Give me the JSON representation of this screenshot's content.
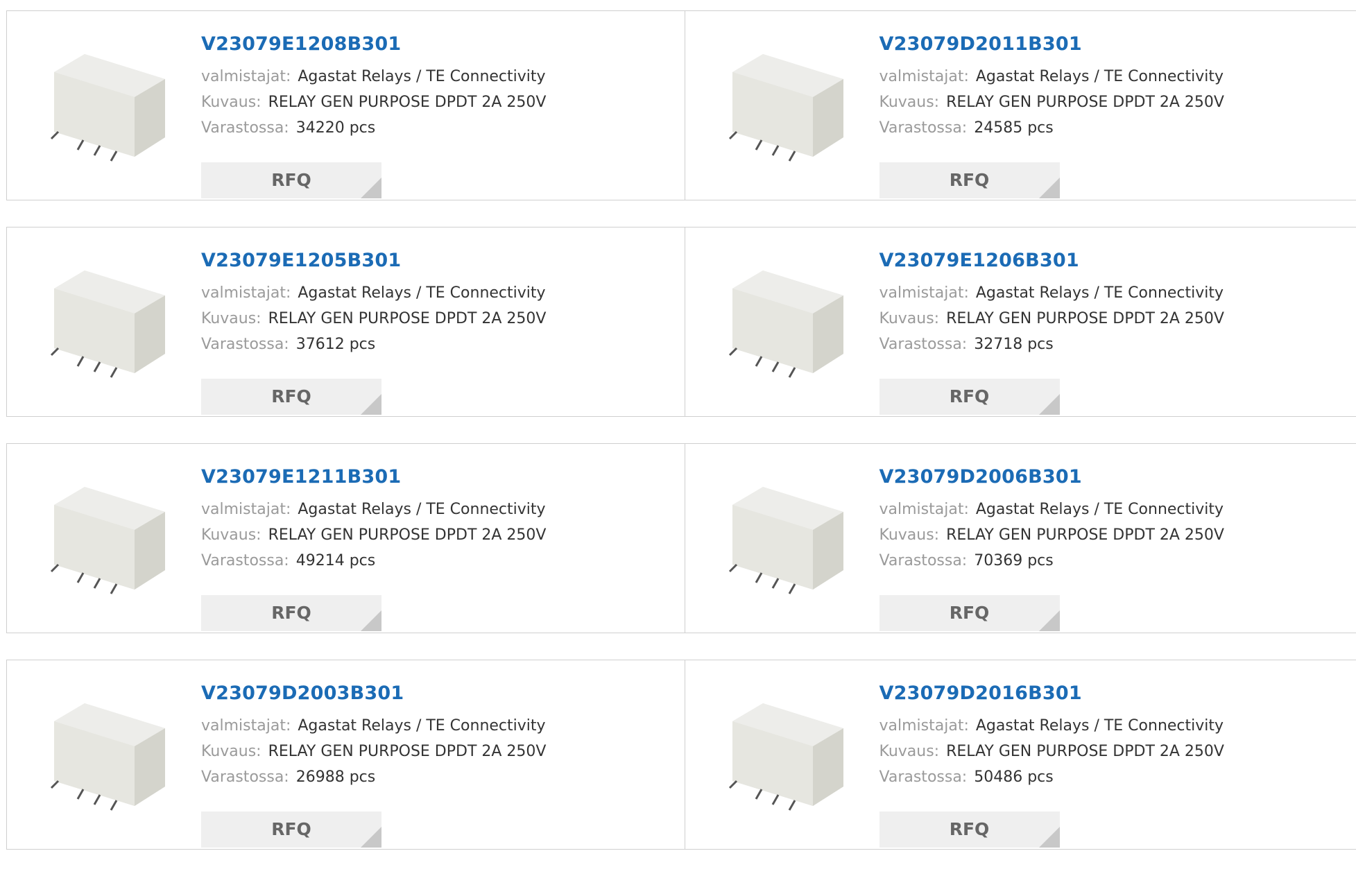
{
  "labels": {
    "manufacturer": "valmistajat:",
    "description": "Kuvaus:",
    "stock": "Varastossa:",
    "rfq": "RFQ"
  },
  "image": {
    "icon": "relay-product-image"
  },
  "colors": {
    "part_link": "#1b6bb5",
    "label": "#9a9a9a",
    "value": "#333333",
    "button_bg": "#efefef"
  },
  "products": [
    {
      "part": "V23079E1208B301",
      "manufacturer": "Agastat Relays / TE Connectivity",
      "description": "RELAY GEN PURPOSE DPDT 2A 250V",
      "stock": "34220 pcs"
    },
    {
      "part": "V23079D2011B301",
      "manufacturer": "Agastat Relays / TE Connectivity",
      "description": "RELAY GEN PURPOSE DPDT 2A 250V",
      "stock": "24585 pcs"
    },
    {
      "part": "V23079E1205B301",
      "manufacturer": "Agastat Relays / TE Connectivity",
      "description": "RELAY GEN PURPOSE DPDT 2A 250V",
      "stock": "37612 pcs"
    },
    {
      "part": "V23079E1206B301",
      "manufacturer": "Agastat Relays / TE Connectivity",
      "description": "RELAY GEN PURPOSE DPDT 2A 250V",
      "stock": "32718 pcs"
    },
    {
      "part": "V23079E1211B301",
      "manufacturer": "Agastat Relays / TE Connectivity",
      "description": "RELAY GEN PURPOSE DPDT 2A 250V",
      "stock": "49214 pcs"
    },
    {
      "part": "V23079D2006B301",
      "manufacturer": "Agastat Relays / TE Connectivity",
      "description": "RELAY GEN PURPOSE DPDT 2A 250V",
      "stock": "70369 pcs"
    },
    {
      "part": "V23079D2003B301",
      "manufacturer": "Agastat Relays / TE Connectivity",
      "description": "RELAY GEN PURPOSE DPDT 2A 250V",
      "stock": "26988 pcs"
    },
    {
      "part": "V23079D2016B301",
      "manufacturer": "Agastat Relays / TE Connectivity",
      "description": "RELAY GEN PURPOSE DPDT 2A 250V",
      "stock": "50486 pcs"
    }
  ]
}
